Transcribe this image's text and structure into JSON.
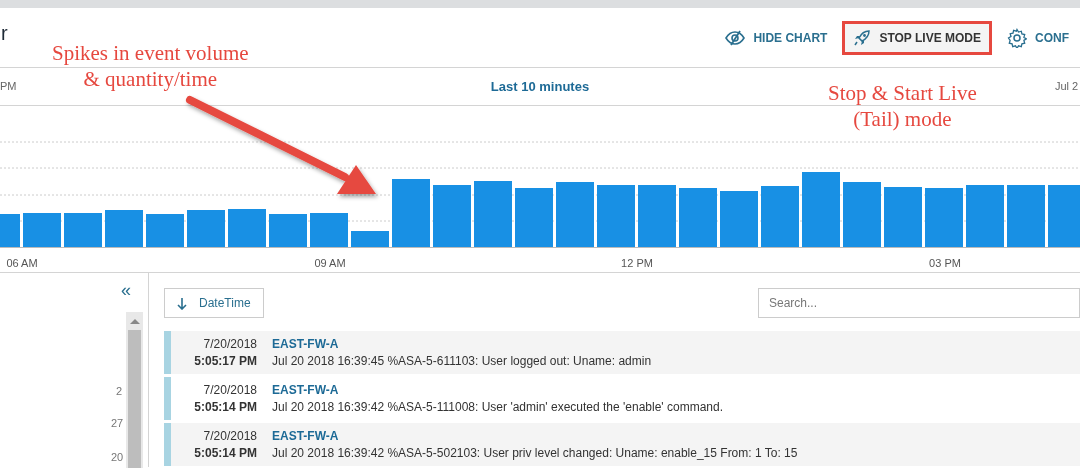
{
  "header": {
    "title_fragment": "r",
    "actions": [
      {
        "kind": "hide",
        "label": "HIDE CHART",
        "highlighted": false,
        "annotated": false
      },
      {
        "kind": "live",
        "label": "STOP LIVE MODE",
        "highlighted": true,
        "annotated": true
      },
      {
        "kind": "config",
        "label": "CONF",
        "highlighted": false,
        "annotated": false
      }
    ]
  },
  "range_bar": {
    "start": "PM",
    "label": "Last 10 minutes",
    "end": "Jul 2"
  },
  "chart": {
    "x_labels": [
      "06 AM",
      "09 AM",
      "12 PM",
      "03 PM"
    ]
  },
  "sidebar": {
    "collapse": "«",
    "counts": [
      "2",
      "27",
      "20"
    ]
  },
  "log": {
    "sort_button": "DateTime",
    "search": {
      "placeholder": "Search..."
    },
    "rows": [
      {
        "date": "7/20/2018",
        "time": "5:05:17 PM",
        "host": "EAST-FW-A",
        "message": "Jul 20 2018 16:39:45 %ASA-5-611103: User logged out: Uname: admin"
      },
      {
        "date": "7/20/2018",
        "time": "5:05:14 PM",
        "host": "EAST-FW-A",
        "message": "Jul 20 2018 16:39:42 %ASA-5-111008: User 'admin' executed the 'enable' command."
      },
      {
        "date": "7/20/2018",
        "time": "5:05:14 PM",
        "host": "EAST-FW-A",
        "message": "Jul 20 2018 16:39:42 %ASA-5-502103: User priv level changed: Uname: enable_15 From: 1 To: 15"
      }
    ]
  },
  "annotations": [
    {
      "kind": "callout",
      "lines": [
        "Spikes in event volume",
        "& quantity/time"
      ]
    },
    {
      "kind": "callout",
      "lines": [
        "Stop & Start Live",
        "(Tail) mode"
      ]
    }
  ]
}
